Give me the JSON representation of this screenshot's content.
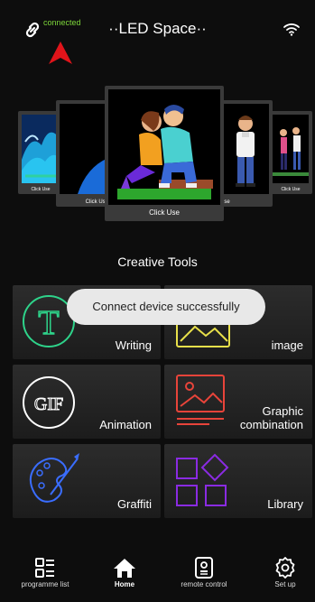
{
  "header": {
    "title": "··LED Space··",
    "status": "connected",
    "link_icon": "link-icon",
    "wifi_icon": "wifi-icon",
    "arrow_color": "#e0141a",
    "status_color": "#7dd63a"
  },
  "carousel": {
    "cards": [
      {
        "caption": "Click Use"
      },
      {
        "caption": "Click Use"
      },
      {
        "caption": "Click Use"
      },
      {
        "caption": "Use"
      },
      {
        "caption": "Click Use"
      }
    ]
  },
  "section_title": "Creative Tools",
  "toast": "Connect device successfully",
  "tools": [
    {
      "label": "Writing",
      "icon": "letter-t-icon",
      "color": "#2ed38a"
    },
    {
      "label": "image",
      "icon": "image-icon",
      "color": "#e8e04a"
    },
    {
      "label": "Animation",
      "icon": "gif-icon",
      "color": "#ffffff"
    },
    {
      "label": "Graphic\ncombination",
      "label_line1": "Graphic",
      "label_line2": "combination",
      "icon": "graphic-icon",
      "color": "#e8443a"
    },
    {
      "label": "Graffiti",
      "icon": "palette-icon",
      "color": "#3a6dff"
    },
    {
      "label": "Library",
      "icon": "shapes-icon",
      "color": "#8a2be2"
    }
  ],
  "tabbar": {
    "items": [
      {
        "label": "programme list",
        "icon": "list-icon"
      },
      {
        "label": "Home",
        "icon": "home-icon",
        "active": true
      },
      {
        "label": "remote control",
        "icon": "remote-icon"
      },
      {
        "label": "Set up",
        "icon": "gear-icon"
      }
    ]
  }
}
